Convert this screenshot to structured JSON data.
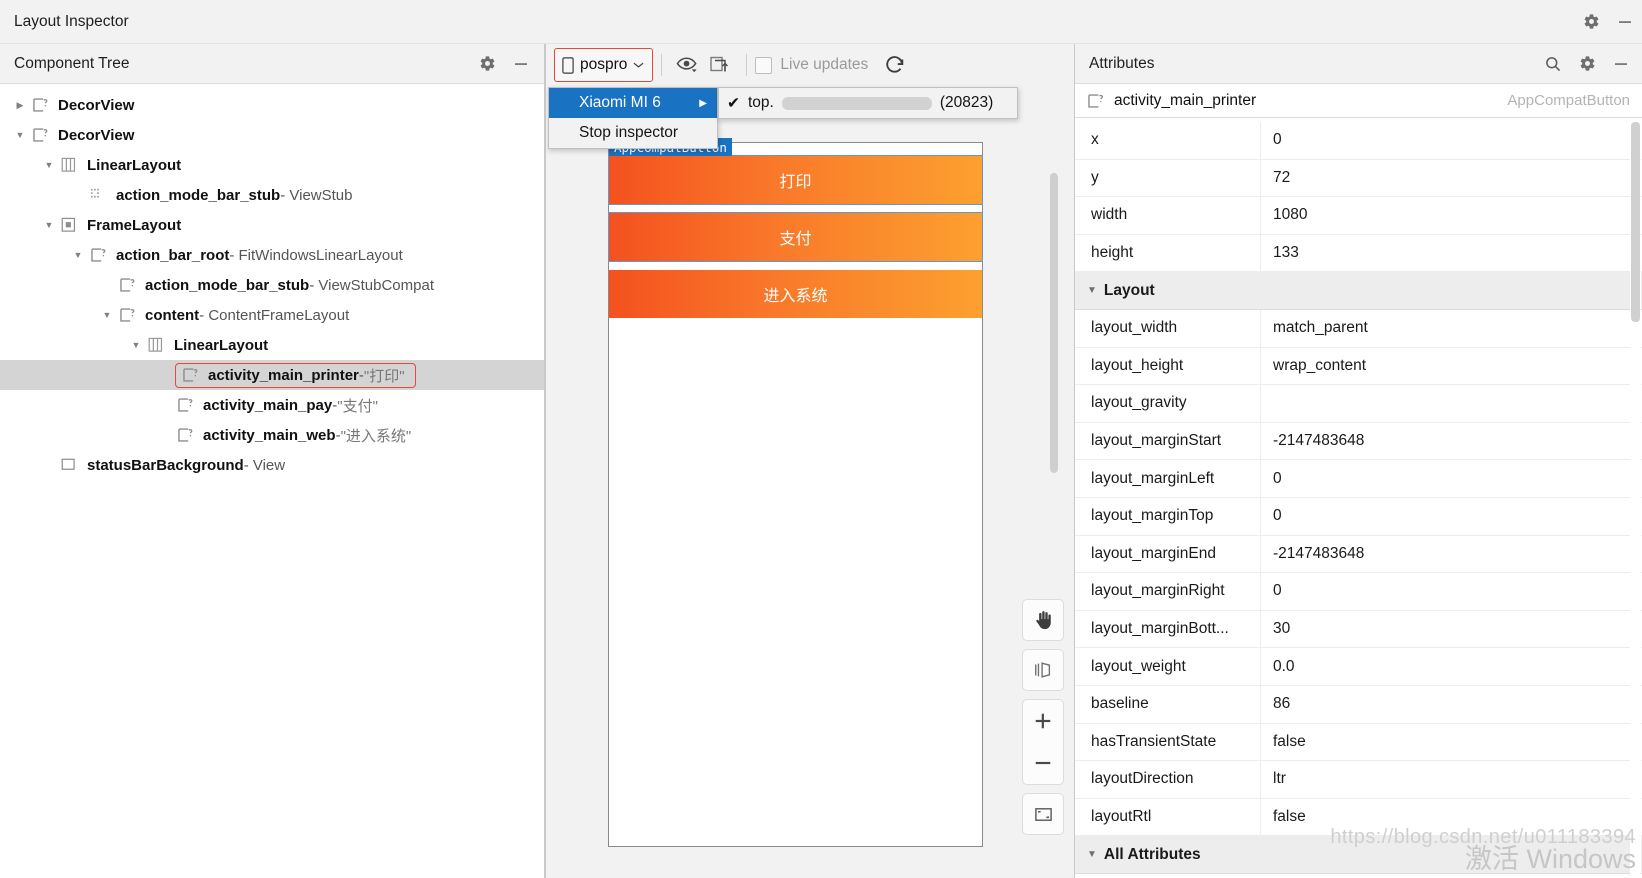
{
  "window": {
    "title": "Layout Inspector",
    "settings_icon": "gear-icon",
    "minimize_icon": "minimize-icon"
  },
  "tree_panel": {
    "header": "Component Tree",
    "settings_icon": "gear-icon",
    "minimize_icon": "minimize-icon",
    "rows": [
      {
        "indent": 0,
        "twisty": "collapsed",
        "icon": "view-unknown-icon",
        "name": "DecorView",
        "type": "",
        "value": "",
        "selected": false
      },
      {
        "indent": 0,
        "twisty": "expanded",
        "icon": "view-unknown-icon",
        "name": "DecorView",
        "type": "",
        "value": "",
        "selected": false
      },
      {
        "indent": 1,
        "twisty": "expanded",
        "icon": "linearlayout-icon",
        "name": "LinearLayout",
        "type": "",
        "value": "",
        "selected": false
      },
      {
        "indent": 2,
        "twisty": "none",
        "icon": "viewstub-icon",
        "name": "action_mode_bar_stub",
        "type": "- ViewStub",
        "value": "",
        "selected": false
      },
      {
        "indent": 1,
        "twisty": "expanded",
        "icon": "framelayout-icon",
        "name": "FrameLayout",
        "type": "",
        "value": "",
        "selected": false
      },
      {
        "indent": 2,
        "twisty": "expanded",
        "icon": "view-unknown-icon",
        "name": "action_bar_root",
        "type": "- FitWindowsLinearLayout",
        "value": "",
        "selected": false
      },
      {
        "indent": 3,
        "twisty": "none",
        "icon": "view-unknown-icon",
        "name": "action_mode_bar_stub",
        "type": "- ViewStubCompat",
        "value": "",
        "selected": false
      },
      {
        "indent": 3,
        "twisty": "expanded",
        "icon": "view-unknown-icon",
        "name": "content",
        "type": "- ContentFrameLayout",
        "value": "",
        "selected": false
      },
      {
        "indent": 4,
        "twisty": "expanded",
        "icon": "linearlayout-icon",
        "name": "LinearLayout",
        "type": "",
        "value": "",
        "selected": false
      },
      {
        "indent": 5,
        "twisty": "none",
        "icon": "view-unknown-icon",
        "name": "activity_main_printer",
        "type": "-",
        "value": "\"打印\"",
        "selected": true
      },
      {
        "indent": 5,
        "twisty": "none",
        "icon": "view-unknown-icon",
        "name": "activity_main_pay",
        "type": "-",
        "value": "\"支付\"",
        "selected": false
      },
      {
        "indent": 5,
        "twisty": "none",
        "icon": "view-unknown-icon",
        "name": "activity_main_web",
        "type": "-",
        "value": "\"进入系统\"",
        "selected": false
      },
      {
        "indent": 1,
        "twisty": "none",
        "icon": "view-icon",
        "name": "statusBarBackground",
        "type": "- View",
        "value": "",
        "selected": false
      }
    ]
  },
  "toolbar": {
    "device_label": "pospro",
    "device_icon": "phone-icon",
    "dropdown_icon": "chevron-down-icon",
    "eye_icon": "eye-dropdown-icon",
    "overlay_icon": "load-overlay-icon",
    "live_updates_label": "Live updates",
    "live_updates_checked": false,
    "refresh_icon": "refresh-icon"
  },
  "menu": {
    "items": [
      {
        "label": "Xiaomi MI 6",
        "highlighted": true,
        "submenu_arrow": "▶"
      },
      {
        "label": "Stop inspector",
        "highlighted": false,
        "submenu_arrow": ""
      }
    ],
    "submenu": [
      {
        "check": "✔",
        "prefix": "top.",
        "redacted": true,
        "suffix": " (20823)"
      }
    ]
  },
  "preview": {
    "selected_badge": "AppCompatButton",
    "buttons": [
      {
        "label": "打印",
        "selected": true
      },
      {
        "label": "支付",
        "selected": true
      },
      {
        "label": "进入系统",
        "selected": false
      }
    ],
    "zoom_tools": [
      {
        "icon": "pan-hand-icon",
        "name": "pan-tool"
      },
      {
        "icon": "layers-3d-icon",
        "name": "toggle-3d"
      },
      {
        "icon": "zoom-in-plus-icon",
        "name": "zoom-in"
      },
      {
        "icon": "zoom-out-minus-icon",
        "name": "zoom-out"
      },
      {
        "icon": "zoom-fit-icon",
        "name": "zoom-to-fit"
      }
    ]
  },
  "attributes": {
    "header": "Attributes",
    "search_icon": "search-icon",
    "settings_icon": "gear-icon",
    "minimize_icon": "minimize-icon",
    "selected_node": "activity_main_printer",
    "selected_class": "AppCompatButton",
    "rows": [
      {
        "kind": "row",
        "key": "x",
        "value": "0"
      },
      {
        "kind": "row",
        "key": "y",
        "value": "72"
      },
      {
        "kind": "row",
        "key": "width",
        "value": "1080"
      },
      {
        "kind": "row",
        "key": "height",
        "value": "133"
      },
      {
        "kind": "group",
        "key": "Layout",
        "value": ""
      },
      {
        "kind": "row",
        "key": "layout_width",
        "value": "match_parent"
      },
      {
        "kind": "row",
        "key": "layout_height",
        "value": "wrap_content"
      },
      {
        "kind": "row",
        "key": "layout_gravity",
        "value": ""
      },
      {
        "kind": "row",
        "key": "layout_marginStart",
        "value": "-2147483648"
      },
      {
        "kind": "row",
        "key": "layout_marginLeft",
        "value": "0"
      },
      {
        "kind": "row",
        "key": "layout_marginTop",
        "value": "0"
      },
      {
        "kind": "row",
        "key": "layout_marginEnd",
        "value": "-2147483648"
      },
      {
        "kind": "row",
        "key": "layout_marginRight",
        "value": "0"
      },
      {
        "kind": "row",
        "key": "layout_marginBott...",
        "value": "30"
      },
      {
        "kind": "row",
        "key": "layout_weight",
        "value": "0.0"
      },
      {
        "kind": "row",
        "key": "baseline",
        "value": "86"
      },
      {
        "kind": "row",
        "key": "hasTransientState",
        "value": "false"
      },
      {
        "kind": "row",
        "key": "layoutDirection",
        "value": "ltr"
      },
      {
        "kind": "row",
        "key": "layoutRtl",
        "value": "false"
      },
      {
        "kind": "group",
        "key": "All Attributes",
        "value": ""
      }
    ]
  },
  "watermark": {
    "url": "https://blog.csdn.net/u011183394",
    "activate": "激活 Windows"
  },
  "colors": {
    "accent_selection": "#1a72c2",
    "highlight_outline": "#e04a37",
    "button_gradient_start": "#f4511e",
    "button_gradient_end": "#fca02f",
    "tree_selected_bg": "#d4d4d4"
  }
}
